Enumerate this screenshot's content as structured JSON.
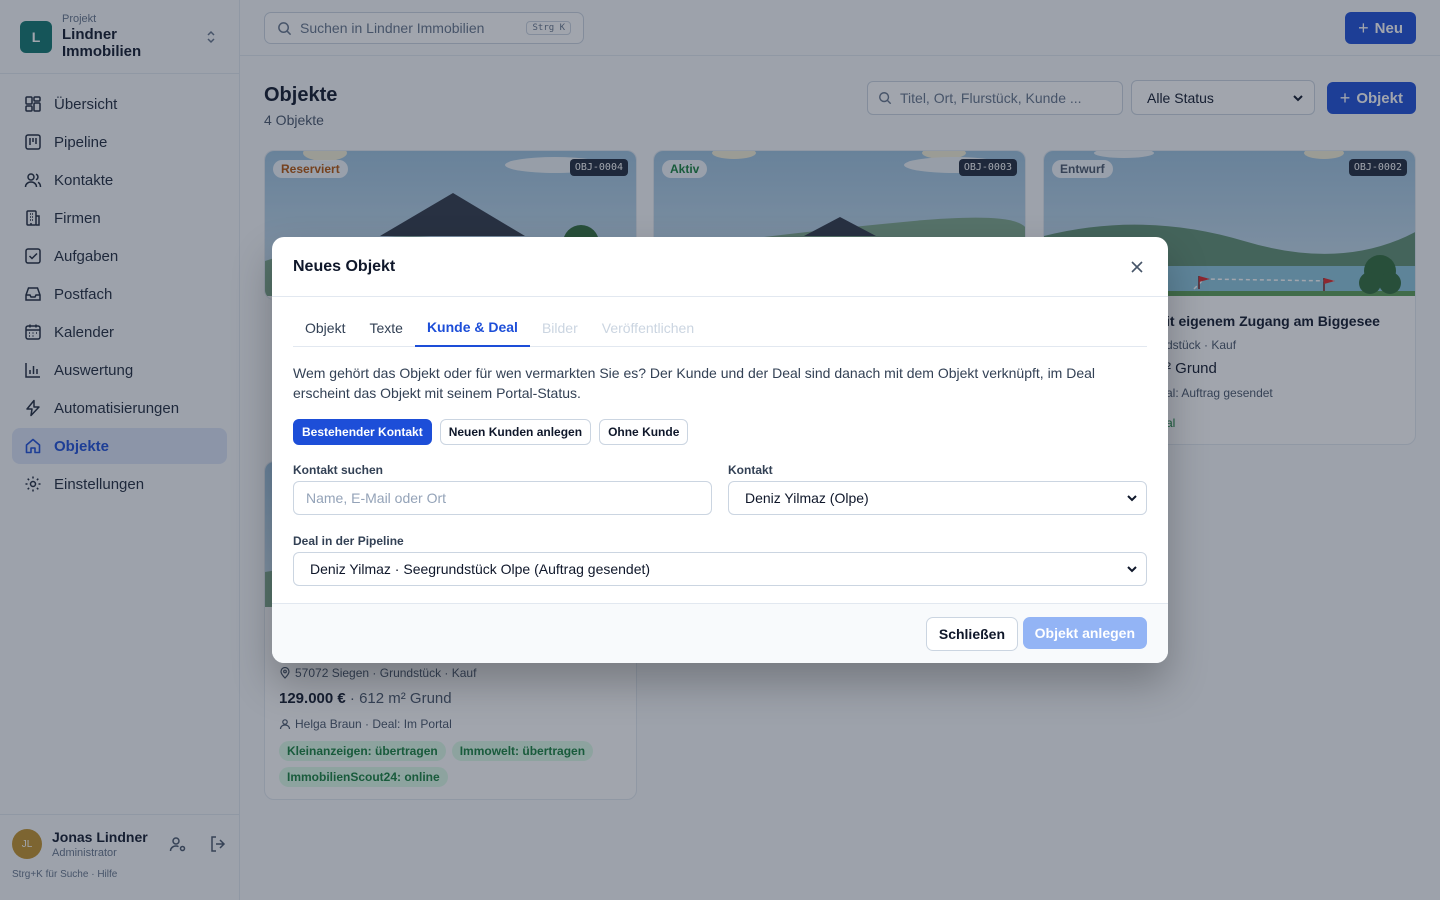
{
  "project": {
    "label": "Projekt",
    "name": "Lindner Immobilien",
    "logo": "L"
  },
  "nav": [
    {
      "label": "Übersicht",
      "icon": "grid-icon",
      "active": false
    },
    {
      "label": "Pipeline",
      "icon": "kanban-icon",
      "active": false
    },
    {
      "label": "Kontakte",
      "icon": "users-icon",
      "active": false
    },
    {
      "label": "Firmen",
      "icon": "building-icon",
      "active": false
    },
    {
      "label": "Aufgaben",
      "icon": "checkbox-icon",
      "active": false
    },
    {
      "label": "Postfach",
      "icon": "inbox-icon",
      "active": false
    },
    {
      "label": "Kalender",
      "icon": "calendar-icon",
      "active": false
    },
    {
      "label": "Auswertung",
      "icon": "bar-chart-icon",
      "active": false
    },
    {
      "label": "Automatisierungen",
      "icon": "bolt-icon",
      "active": false
    },
    {
      "label": "Objekte",
      "icon": "home-icon",
      "active": true
    },
    {
      "label": "Einstellungen",
      "icon": "gear-icon",
      "active": false
    }
  ],
  "user": {
    "initials": "JL",
    "name": "Jonas Lindner",
    "role": "Administrator",
    "hint": "Strg+K für Suche · Hilfe"
  },
  "topbar": {
    "search_placeholder": "Suchen in Lindner Immobilien",
    "shortcut": "Strg K",
    "new_label": "Neu"
  },
  "page": {
    "title": "Objekte",
    "count": "4 Objekte",
    "filter_placeholder": "Titel, Ort, Flurstück, Kunde ...",
    "status_filter": "Alle Status",
    "add_label": "Objekt"
  },
  "cards": [
    {
      "status": "Reserviert",
      "status_color": "#b45309",
      "id": "OBJ-0004"
    },
    {
      "status": "Aktiv",
      "status_color": "#15803d",
      "id": "OBJ-0003"
    },
    {
      "status": "Entwurf",
      "status_color": "#475569",
      "id": "OBJ-0002",
      "title_fragment": "it eigenem Zugang am Biggesee",
      "meta_fragment": "dstück · Kauf",
      "area_fragment": "² Grund",
      "deal_fragment": "al: Auftrag gesendet",
      "portal_fragment": "al"
    },
    {
      "meta": "57072 Siegen · Grundstück · Kauf",
      "price": "129.000 €",
      "area": " · 612 m² Grund",
      "contact": "Helga Braun · Deal: Im Portal",
      "portals": [
        "Kleinanzeigen: übertragen",
        "Immowelt: übertragen",
        "ImmobilienScout24: online"
      ]
    }
  ],
  "modal": {
    "title": "Neues Objekt",
    "tabs": [
      {
        "label": "Objekt",
        "state": "normal"
      },
      {
        "label": "Texte",
        "state": "normal"
      },
      {
        "label": "Kunde & Deal",
        "state": "active"
      },
      {
        "label": "Bilder",
        "state": "disabled"
      },
      {
        "label": "Veröffentlichen",
        "state": "disabled"
      }
    ],
    "description": "Wem gehört das Objekt oder für wen vermarkten Sie es? Der Kunde und der Deal sind danach mit dem Objekt verknüpft, im Deal erscheint das Objekt mit seinem Portal-Status.",
    "options": [
      {
        "label": "Bestehender Kontakt",
        "active": true
      },
      {
        "label": "Neuen Kunden anlegen",
        "active": false
      },
      {
        "label": "Ohne Kunde",
        "active": false
      }
    ],
    "contact_search_label": "Kontakt suchen",
    "contact_search_placeholder": "Name, E-Mail oder Ort",
    "contact_label": "Kontakt",
    "contact_value": "Deniz Yilmaz (Olpe)",
    "deal_label": "Deal in der Pipeline",
    "deal_value": "Deniz Yilmaz · Seegrundstück Olpe (Auftrag gesendet)",
    "close_label": "Schließen",
    "create_label": "Objekt anlegen"
  }
}
